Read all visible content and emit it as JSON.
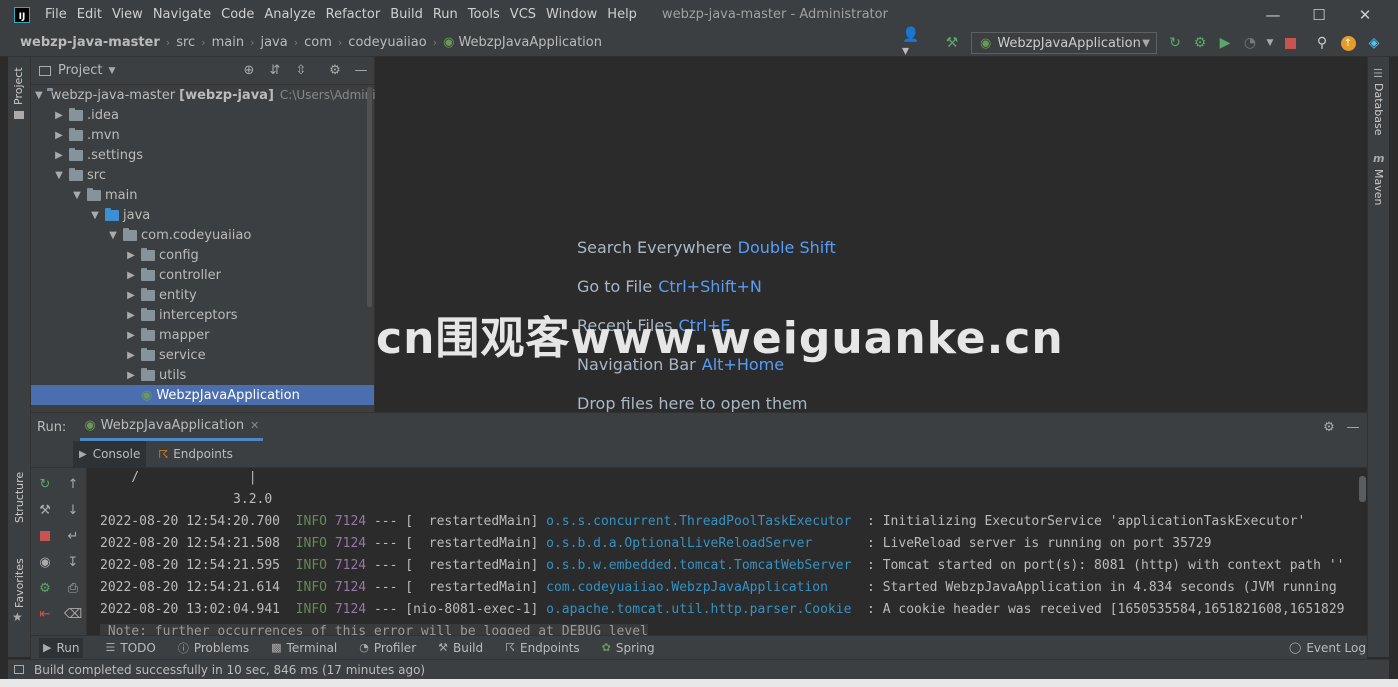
{
  "menu": [
    "File",
    "Edit",
    "View",
    "Navigate",
    "Code",
    "Analyze",
    "Refactor",
    "Build",
    "Run",
    "Tools",
    "VCS",
    "Window",
    "Help"
  ],
  "window_title": "webzp-java-master - Administrator",
  "breadcrumb": [
    "webzp-java-master",
    "src",
    "main",
    "java",
    "com",
    "codeyuaiiao",
    "WebzpJavaApplication"
  ],
  "run_config": "WebzpJavaApplication",
  "project_panel": {
    "title": "Project",
    "root_label": "webzp-java-master",
    "root_module": "[webzp-java]",
    "root_path": "C:\\Users\\Adminis",
    "items": [
      {
        "label": ".idea"
      },
      {
        "label": ".mvn"
      },
      {
        "label": ".settings"
      },
      {
        "label": "src"
      },
      {
        "label": "main"
      },
      {
        "label": "java"
      },
      {
        "label": "com.codeyuaiiao"
      },
      {
        "label": "config"
      },
      {
        "label": "controller"
      },
      {
        "label": "entity"
      },
      {
        "label": "interceptors"
      },
      {
        "label": "mapper"
      },
      {
        "label": "service"
      },
      {
        "label": "utils"
      },
      {
        "label": "WebzpJavaApplication"
      }
    ]
  },
  "editor_hints": [
    {
      "text": "Search Everywhere",
      "key": "Double Shift"
    },
    {
      "text": "Go to File",
      "key": "Ctrl+Shift+N"
    },
    {
      "text": "Recent Files",
      "key": "Ctrl+E"
    },
    {
      "text": "Navigation Bar",
      "key": "Alt+Home"
    },
    {
      "text": "Drop files here to open them",
      "key": ""
    }
  ],
  "watermark": "cn围观客www.weiguanke.cn",
  "run_panel": {
    "label": "Run:",
    "tab": "WebzpJavaApplication",
    "subtabs": [
      "Console",
      "Endpoints"
    ]
  },
  "console": {
    "pre1": "    /              |",
    "pre2": "                 3.2.0",
    "lines": [
      {
        "ts": "2022-08-20 12:54:20.700",
        "level": "INFO",
        "pid": "7124",
        "thread": "--- [  restartedMain]",
        "cls": "o.s.s.concurrent.ThreadPoolTaskExecutor ",
        "msg": " : Initializing ExecutorService 'applicationTaskExecutor'"
      },
      {
        "ts": "2022-08-20 12:54:21.508",
        "level": "INFO",
        "pid": "7124",
        "thread": "--- [  restartedMain]",
        "cls": "o.s.b.d.a.OptionalLiveReloadServer      ",
        "msg": " : LiveReload server is running on port 35729"
      },
      {
        "ts": "2022-08-20 12:54:21.595",
        "level": "INFO",
        "pid": "7124",
        "thread": "--- [  restartedMain]",
        "cls": "o.s.b.w.embedded.tomcat.TomcatWebServer ",
        "msg": " : Tomcat started on port(s): 8081 (http) with context path ''"
      },
      {
        "ts": "2022-08-20 12:54:21.614",
        "level": "INFO",
        "pid": "7124",
        "thread": "--- [  restartedMain]",
        "cls": "com.codeyuaiiao.WebzpJavaApplication    ",
        "msg": " : Started WebzpJavaApplication in 4.834 seconds (JVM running"
      },
      {
        "ts": "2022-08-20 13:02:04.941",
        "level": "INFO",
        "pid": "7124",
        "thread": "--- [nio-8081-exec-1]",
        "cls": "o.apache.tomcat.util.http.parser.Cookie ",
        "msg": " : A cookie header was received [1650535584,1651821608,1651829"
      }
    ],
    "note": " Note: further occurrences of this error will be logged at DEBUG level"
  },
  "bottom_tabs": [
    "Run",
    "TODO",
    "Problems",
    "Terminal",
    "Profiler",
    "Build",
    "Endpoints",
    "Spring"
  ],
  "event_log": "Event Log",
  "status": "Build completed successfully in 10 sec, 846 ms (17 minutes ago)",
  "side_tabs": {
    "project": "Project",
    "structure": "Structure",
    "favorites": "Favorites",
    "database": "Database",
    "maven": "Maven"
  }
}
